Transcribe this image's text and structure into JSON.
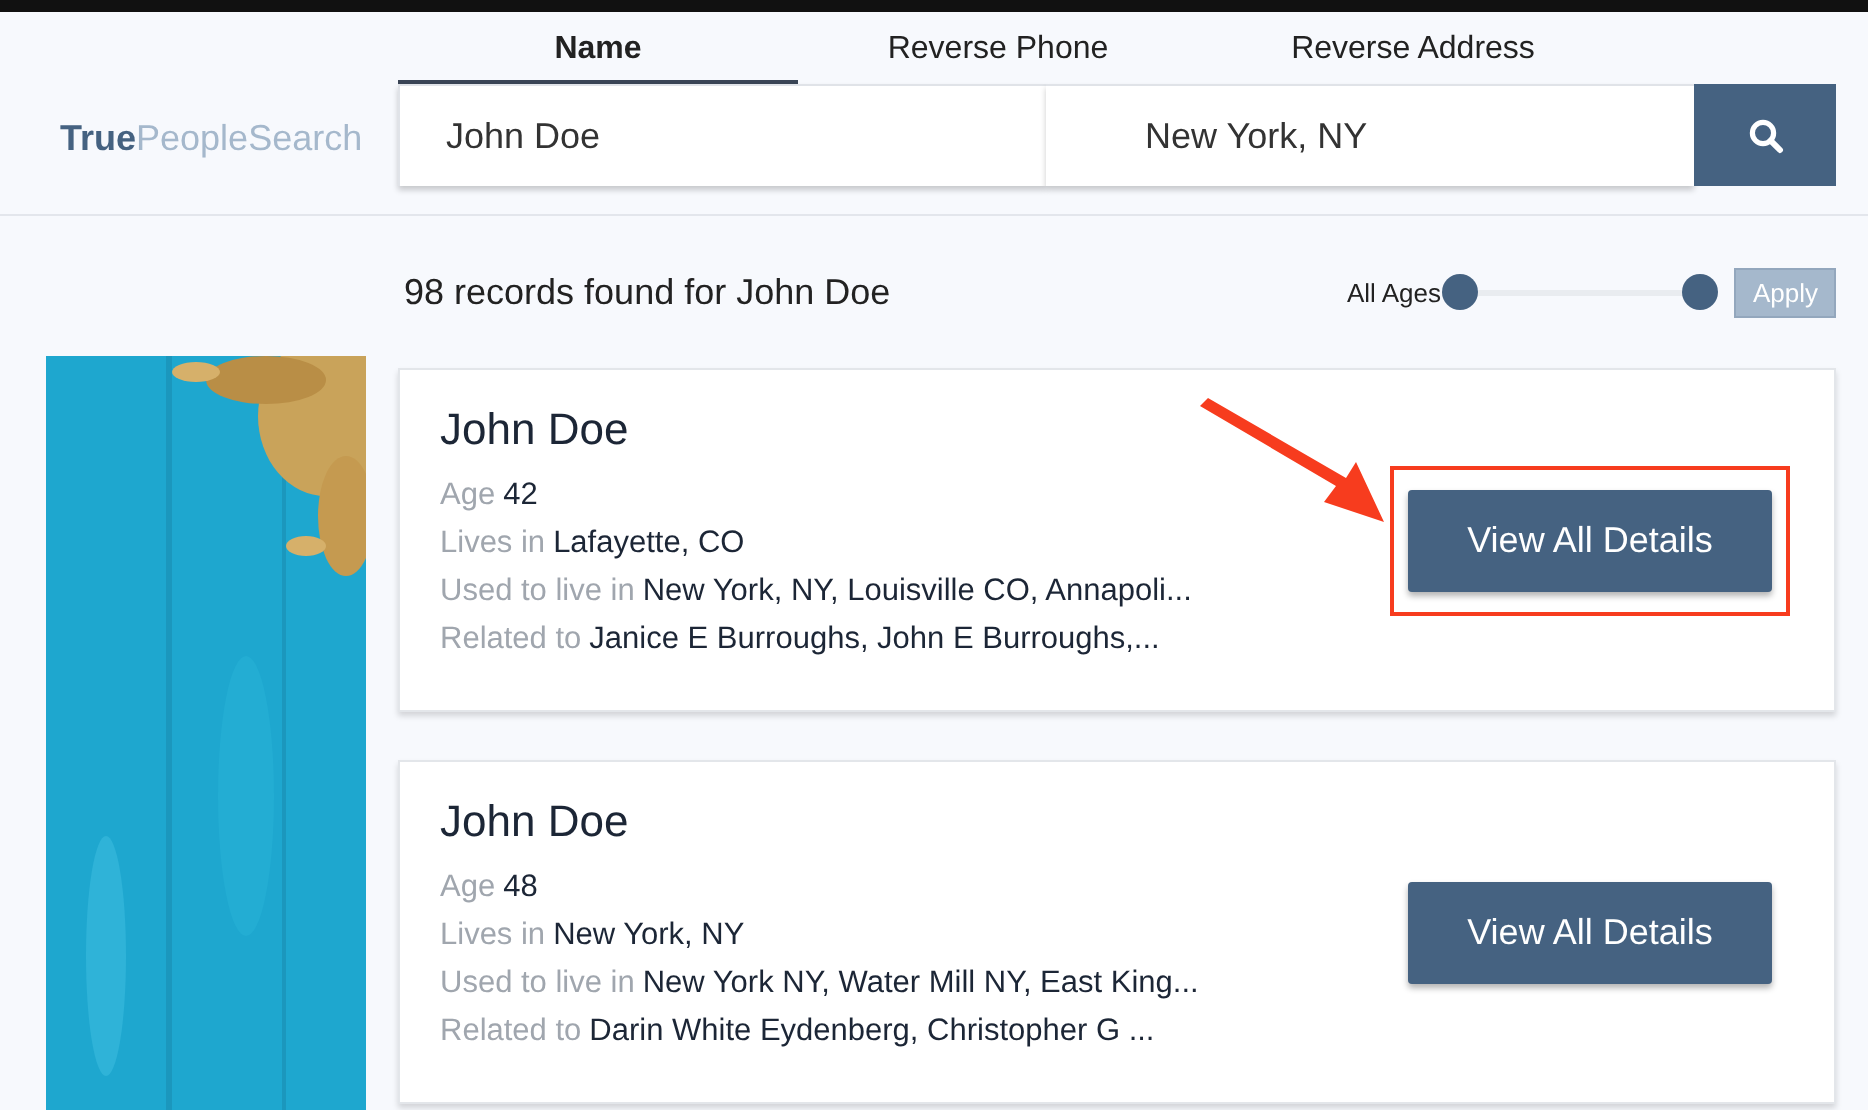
{
  "logo": {
    "bold": "True",
    "light": "PeopleSearch"
  },
  "tabs": [
    {
      "label": "Name",
      "selected": true
    },
    {
      "label": "Reverse Phone",
      "selected": false
    },
    {
      "label": "Reverse Address",
      "selected": false
    }
  ],
  "search": {
    "name_value": "John Doe",
    "location_value": "New York, NY"
  },
  "results_header": "98 records found for John Doe",
  "age_filter": {
    "label": "All Ages",
    "thumbs": [
      {
        "level": 0
      },
      {
        "level": 1
      }
    ],
    "apply": {
      "label": "Apply",
      "disabled": true
    }
  },
  "results": [
    {
      "name": "John Doe",
      "highlighted": true,
      "fields": [
        {
          "label": "Age",
          "value": "42"
        },
        {
          "label": "Lives in",
          "value": "Lafayette, CO"
        },
        {
          "label": "Used to live in",
          "value": "New York, NY, Louisville CO, Annapoli..."
        },
        {
          "label": "Related to",
          "value": "Janice E Burroughs, John E Burroughs,..."
        }
      ],
      "button": "View All Details"
    },
    {
      "name": "John Doe",
      "highlighted": false,
      "fields": [
        {
          "label": "Age",
          "value": "48"
        },
        {
          "label": "Lives in",
          "value": "New York, NY"
        },
        {
          "label": "Used to live in",
          "value": "New York NY, Water Mill NY, East King..."
        },
        {
          "label": "Related to",
          "value": "Darin White Eydenberg, Christopher G ..."
        }
      ],
      "button": "View All Details"
    }
  ]
}
